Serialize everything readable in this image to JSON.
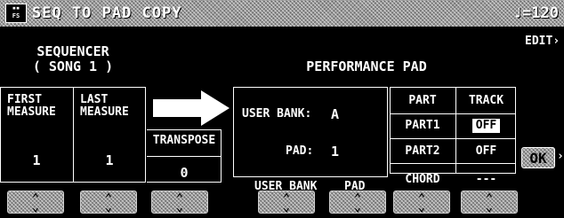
{
  "header": {
    "title": "SEQ TO PAD COPY",
    "tempo": "♩=120",
    "logo": "FS"
  },
  "sequencer": {
    "title_line1": "SEQUENCER",
    "title_line2": "( SONG 1 )"
  },
  "first_measure": {
    "label_line1": "FIRST",
    "label_line2": "MEASURE",
    "value": "1"
  },
  "last_measure": {
    "label_line1": "LAST",
    "label_line2": "MEASURE",
    "value": "1"
  },
  "transpose": {
    "label": "TRANSPOSE",
    "value": "0"
  },
  "performance_pad": {
    "title": "PERFORMANCE PAD",
    "user_bank_label": "USER BANK:",
    "user_bank_value": "A",
    "pad_label": "PAD:",
    "pad_value": "1"
  },
  "part_table": {
    "header_part": "PART",
    "header_track": "TRACK",
    "rows": [
      {
        "part": "PART1",
        "track": "OFF"
      },
      {
        "part": "PART2",
        "track": "OFF"
      },
      {
        "part": "CHORD",
        "track": "---"
      }
    ]
  },
  "edit_label": "EDIT",
  "ok_label": "OK",
  "bottom_labels": {
    "user_bank": "USER BANK",
    "pad": "PAD"
  },
  "arrow_glyph": "⌃⌄"
}
